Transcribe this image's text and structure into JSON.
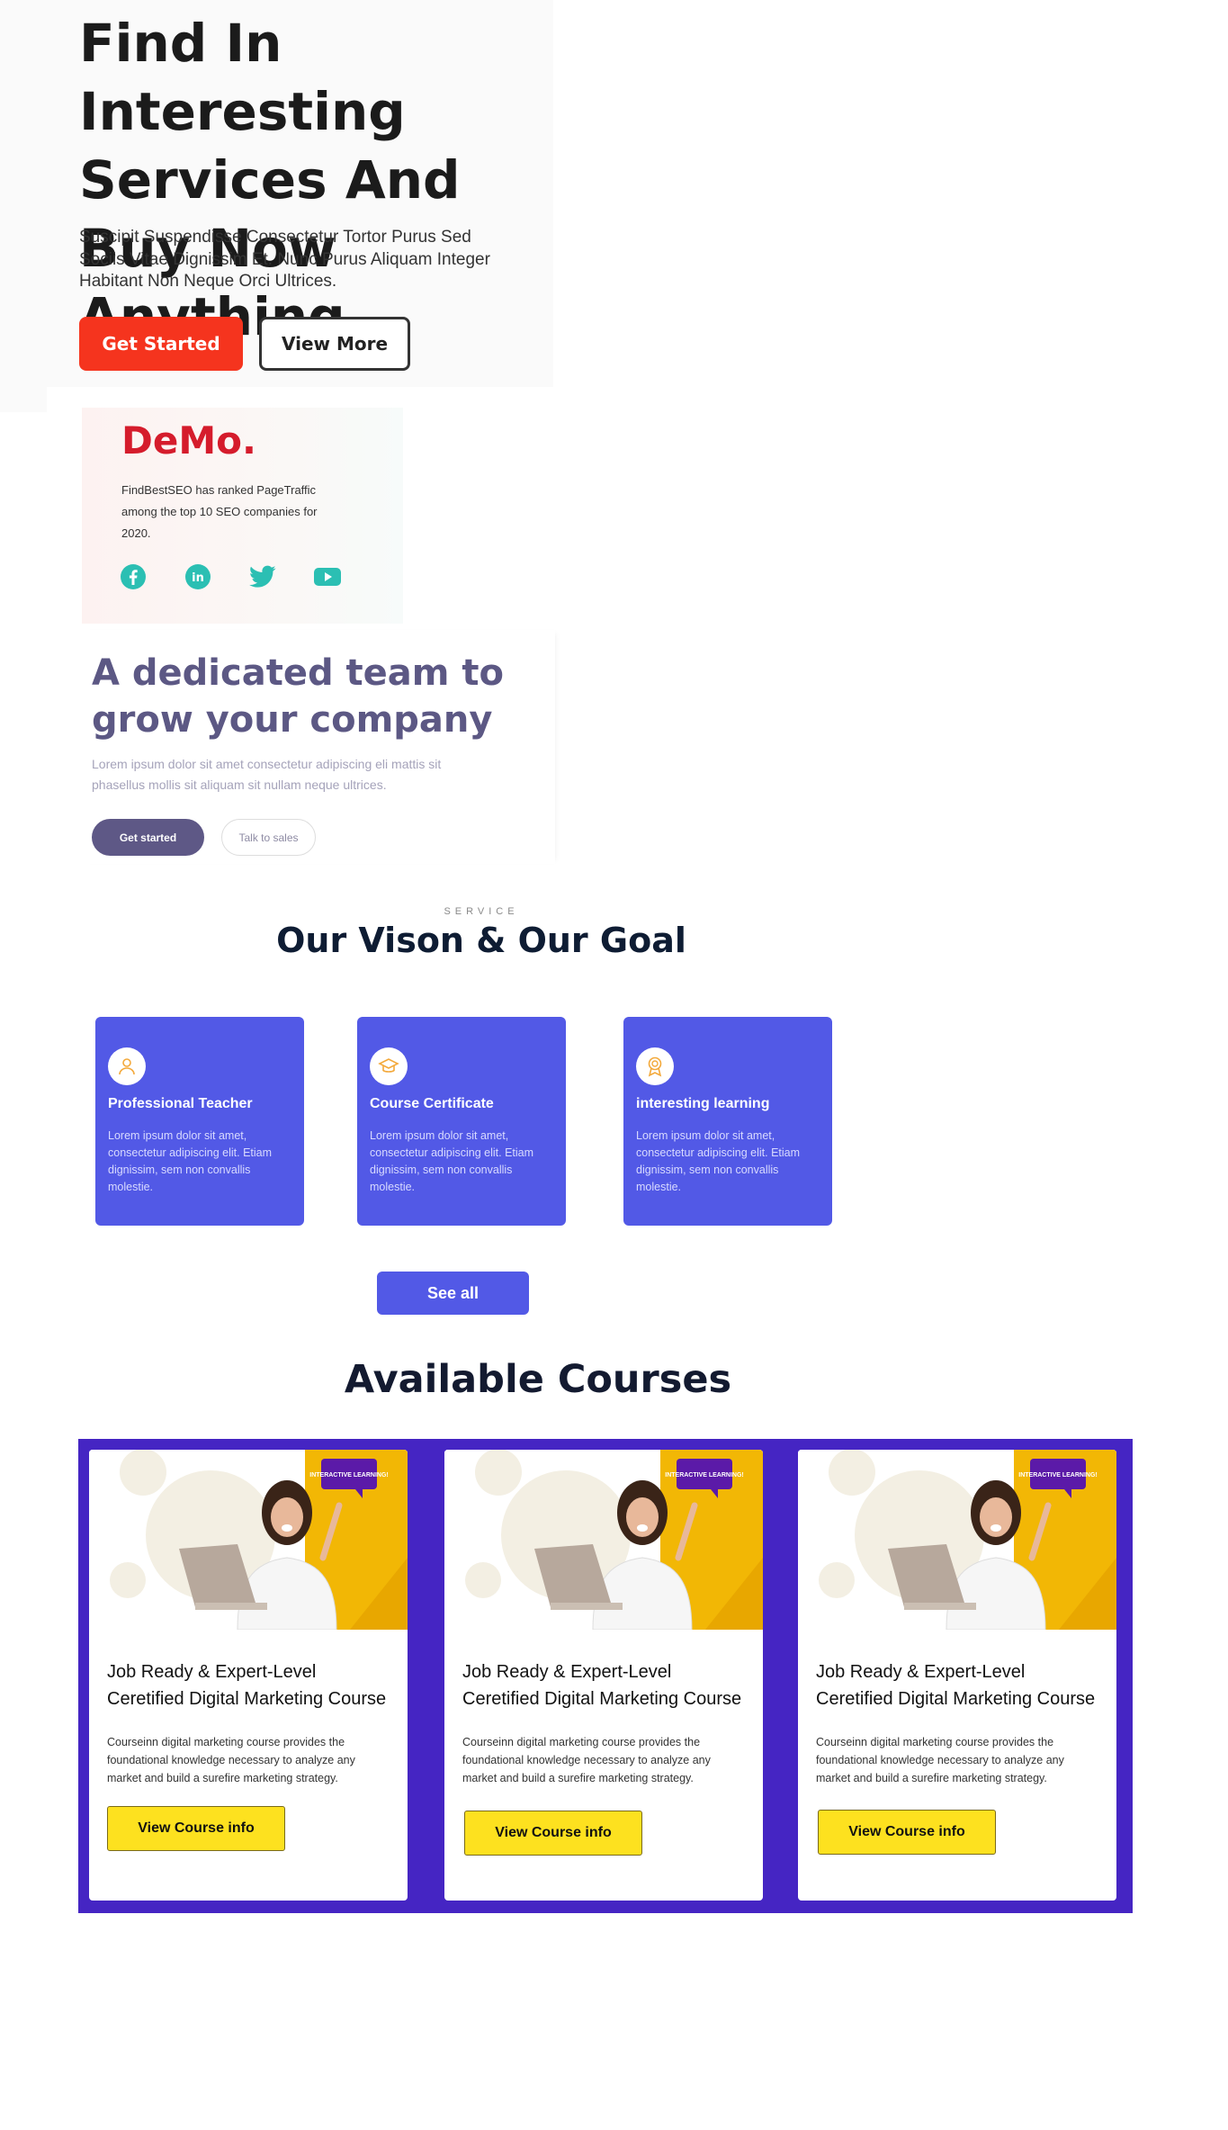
{
  "hero": {
    "title": "Find In Interesting Services And Buy Now Anything.",
    "description": "Suscipit Suspendisse Consectetur Tortor Purus Sed Sociis Vitae Dignissim Et. Nunc Purus Aliquam Integer Habitant Non Neque Orci Ultrices.",
    "primary_button": "Get Started",
    "secondary_button": "View More",
    "accent_color": "#f5341e"
  },
  "demo": {
    "logo": "DeMo.",
    "text": "FindBestSEO has ranked PageTraffic among the top 10 SEO companies for 2020.",
    "social": [
      "facebook-icon",
      "linkedin-icon",
      "twitter-icon",
      "youtube-icon"
    ],
    "social_color": "#2bbfb3"
  },
  "team": {
    "title": "A dedicated team to grow your company",
    "description": "Lorem ipsum dolor sit amet consectetur adipiscing eli mattis sit phasellus mollis sit aliquam sit nullam neque ultrices.",
    "primary_button": "Get started",
    "secondary_button": "Talk to sales"
  },
  "service": {
    "label": "SERVICE",
    "title": "Our Vison & Our Goal",
    "cards": [
      {
        "title": "Professional Teacher",
        "icon": "user-icon",
        "description": "Lorem ipsum dolor sit amet, consectetur adipiscing elit. Etiam dignissim, sem non convallis molestie."
      },
      {
        "title": "Course Certificate",
        "icon": "graduation-cap-icon",
        "description": "Lorem ipsum dolor sit amet, consectetur adipiscing elit. Etiam dignissim, sem non convallis molestie."
      },
      {
        "title": "interesting learning",
        "icon": "award-icon",
        "description": "Lorem ipsum dolor sit amet, consectetur adipiscing elit. Etiam dignissim, sem non convallis molestie."
      }
    ],
    "see_all": "See all",
    "card_color": "#5259e6"
  },
  "courses": {
    "title": "Available Courses",
    "panel_color": "#4525c3",
    "items": [
      {
        "badge": "INTERACTIVE LEARNING!",
        "title": "Job Ready & Expert-Level Ceretified Digital Marketing Course",
        "description": "Courseinn digital marketing course provides the foundational knowledge necessary to analyze any market and build a surefire marketing strategy.",
        "button": "View Course info"
      },
      {
        "badge": "INTERACTIVE LEARNING!",
        "title": "Job Ready & Expert-Level Ceretified Digital Marketing Course",
        "description": "Courseinn digital marketing course provides the foundational knowledge necessary to analyze any market and build a surefire marketing strategy.",
        "button": "View Course info"
      },
      {
        "badge": "INTERACTIVE LEARNING!",
        "title": "Job Ready & Expert-Level Ceretified Digital Marketing Course",
        "description": "Courseinn digital marketing course provides the foundational knowledge necessary to analyze any market and build a surefire marketing strategy.",
        "button": "View Course info"
      }
    ]
  }
}
